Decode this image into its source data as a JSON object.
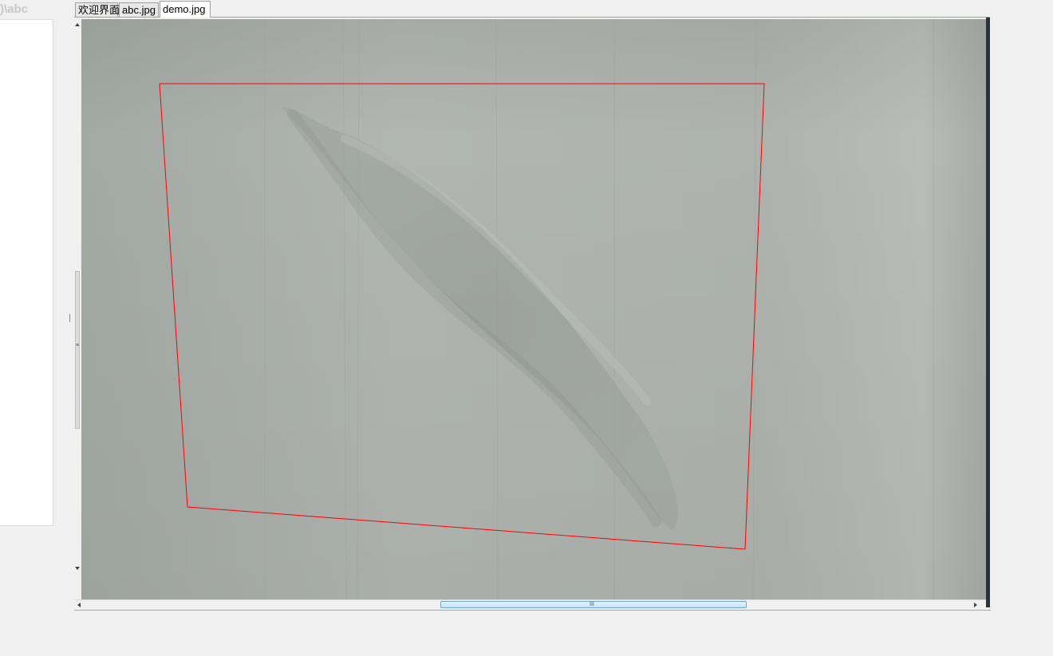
{
  "left_panel": {
    "title": ")\\abc"
  },
  "tabs": [
    {
      "label": "欢迎界面",
      "active": false
    },
    {
      "label": "abc.jpg",
      "active": false
    },
    {
      "label": "demo.jpg",
      "active": true
    }
  ],
  "viewer": {
    "file": "demo.jpg",
    "selection_color": "#ff0000",
    "image_tone": "#a9aeaa"
  },
  "scrollbars": {
    "vertical_grip": "≡",
    "horizontal_grip": "III"
  }
}
